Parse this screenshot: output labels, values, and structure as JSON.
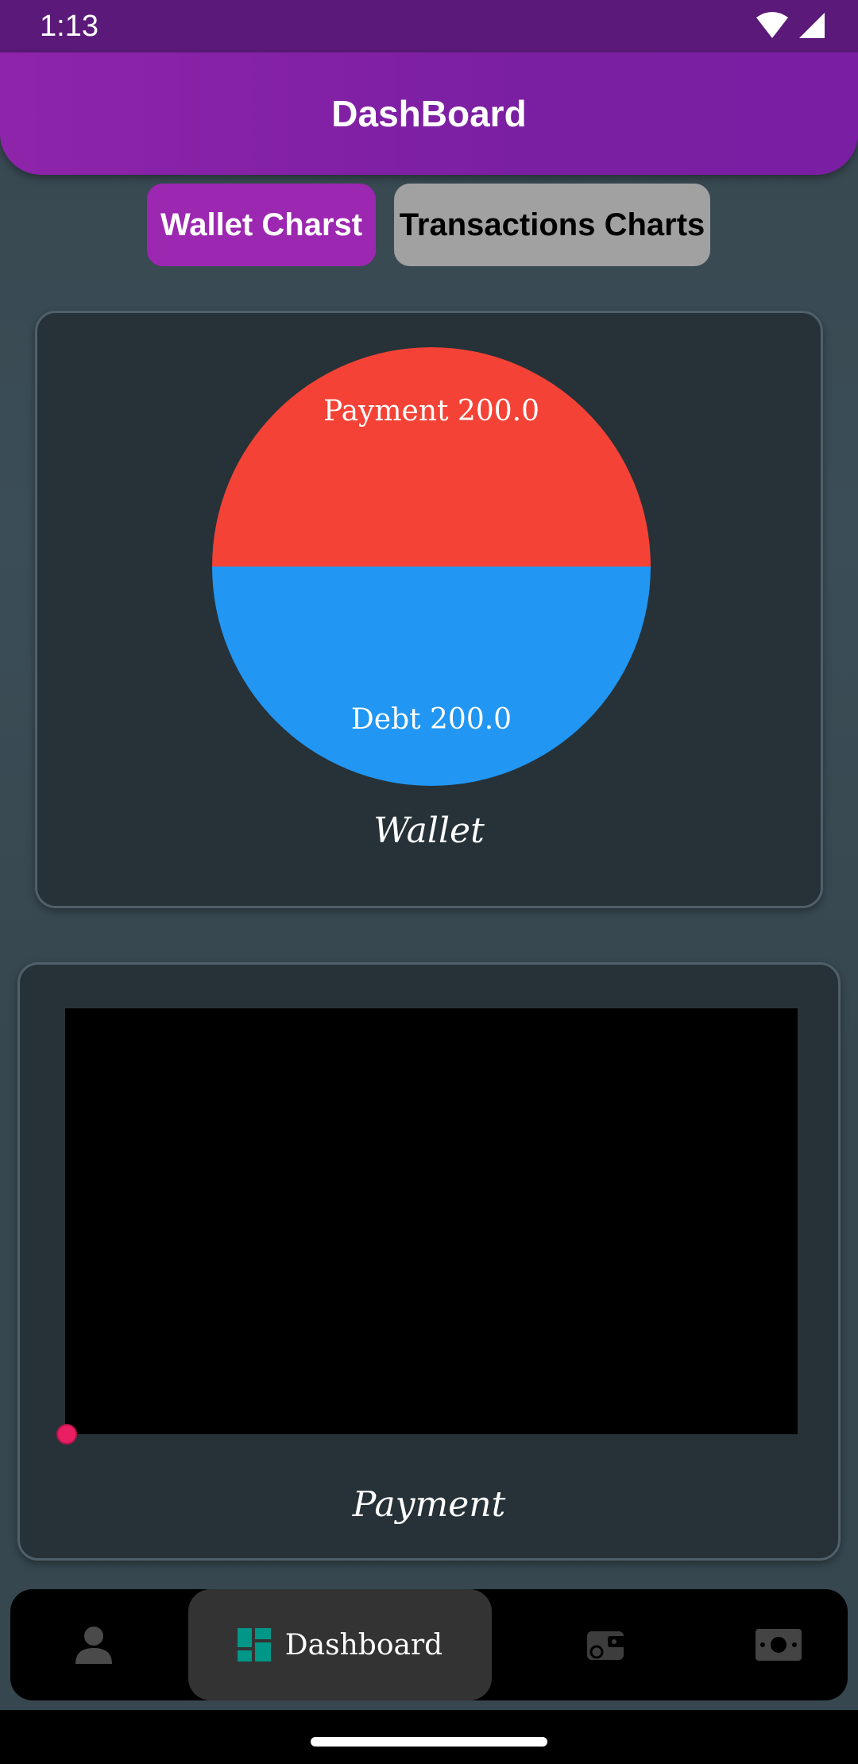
{
  "status_bar": {
    "time": "1:13"
  },
  "app_bar": {
    "title": "DashBoard"
  },
  "toggles": {
    "wallet_label": "Wallet Charst",
    "transactions_label": "Transactions Charts"
  },
  "wallet_card": {
    "caption": "Wallet",
    "chart_data": {
      "type": "pie",
      "slices": [
        {
          "label": "Payment 200.0",
          "name": "Payment",
          "value": 200.0,
          "color": "#f44336"
        },
        {
          "label": "Debt 200.0",
          "name": "Debt",
          "value": 200.0,
          "color": "#2196f3"
        }
      ]
    }
  },
  "payment_card": {
    "caption": "Payment",
    "chart_data": {
      "type": "line",
      "points": [
        {
          "x": 0,
          "y": 0
        }
      ],
      "point_color": "#e91e63",
      "background": "#000000"
    }
  },
  "bottom_nav": {
    "items": [
      {
        "icon": "person-icon"
      },
      {
        "icon": "dashboard-icon",
        "label": "Dashboard",
        "active": true
      },
      {
        "icon": "wallet-icon"
      },
      {
        "icon": "money-icon"
      }
    ]
  },
  "colors": {
    "accent": "#9c27b0",
    "app_bar": "#7b1fa2",
    "status_bar": "#5b1a7a",
    "card": "#263238",
    "background": "#37474f",
    "dashboard_icon": "#009688"
  }
}
